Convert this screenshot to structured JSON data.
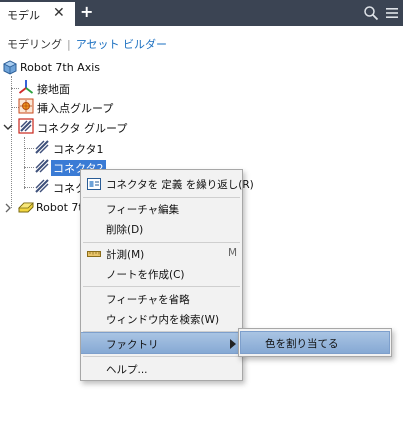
{
  "tabs": {
    "model_label": "モデル",
    "close": "✕",
    "add": "+"
  },
  "modes": {
    "modeling": "モデリング",
    "separator": "|",
    "asset_builder": "アセット ビルダー"
  },
  "tree": {
    "root": "Robot 7th Axis",
    "ground": "接地面",
    "insert_group": "挿入点グループ",
    "connector_group": "コネクタ グループ",
    "connector1": "コネクタ1",
    "connector2": "コネクタ2",
    "connector3_partial": "コネク",
    "robot_partial": "Robot 7th"
  },
  "context_menu": {
    "items": [
      {
        "label": "コネクタを 定義 を繰り返し(R)"
      },
      {
        "label": "フィーチャ編集"
      },
      {
        "label": "削除(D)"
      },
      {
        "label": "計測(M)",
        "shortcut": "M"
      },
      {
        "label": "ノートを作成(C)"
      },
      {
        "label": "フィーチャを省略"
      },
      {
        "label": "ウィンドウ内を検索(W)"
      },
      {
        "label": "ファクトリ"
      },
      {
        "label": "ヘルプ..."
      }
    ]
  },
  "submenu": {
    "item": "色を割り当てる"
  },
  "colors": {
    "tabbar": "#3b4453",
    "link": "#1a6fc0",
    "selection": "#3a7bd5",
    "highlight": "#a9c4e3"
  }
}
